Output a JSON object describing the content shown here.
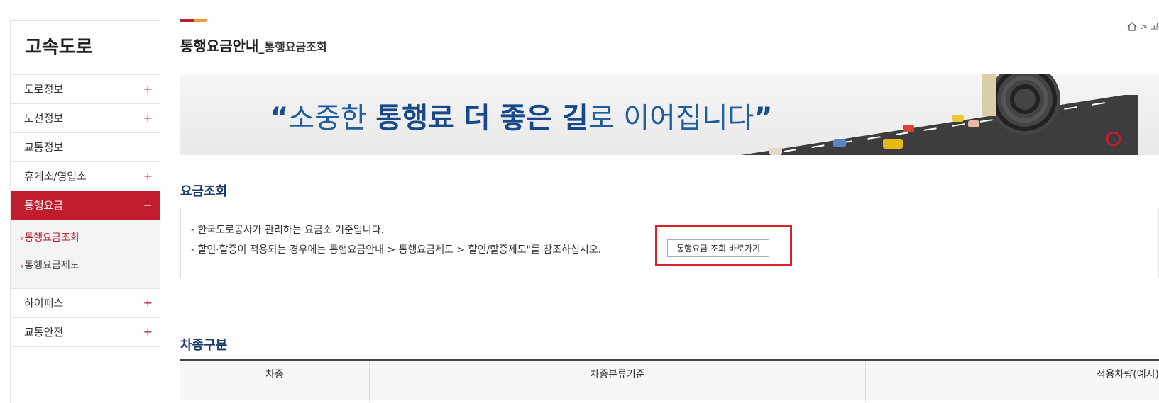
{
  "sidebar": {
    "title": "고속도로",
    "items": [
      {
        "label": "도로정보",
        "sign": "+"
      },
      {
        "label": "노선정보",
        "sign": "+"
      },
      {
        "label": "교통정보",
        "sign": ""
      },
      {
        "label": "휴게소/영업소",
        "sign": "+"
      },
      {
        "label": "통행요금",
        "sign": "−"
      }
    ],
    "sub_items": [
      {
        "label": "통행요금조회"
      },
      {
        "label": "통행요금제도"
      }
    ],
    "items_after": [
      {
        "label": "하이패스",
        "sign": "+"
      },
      {
        "label": "교통안전",
        "sign": "+"
      }
    ]
  },
  "header": {
    "title": "통행요금안내",
    "subtitle": "_통행요금조회",
    "breadcrumb": "> 고"
  },
  "banner": {
    "open_quote": "“",
    "text_1": "소중한 ",
    "bold_1": "통행료 더 좋은 길",
    "text_2": "로 이어집니다",
    "close_quote": "”"
  },
  "section_fee": {
    "title": "요금조회",
    "line_1": "- 한국도로공사가 관리하는 요금소 기준입니다.",
    "line_2": "- 할인·할증이 적용되는 경우에는 통행요금안내 > 통행요금제도 > 할인/할증제도\"를 참조하십시오.",
    "button_label": "통행요금 조회 바로가기"
  },
  "section_vehicle": {
    "title": "차종구분",
    "columns": [
      "차종",
      "차종분류기준",
      "적용차량(예시)"
    ]
  },
  "colors": {
    "accent_red": "#c01e2e",
    "title_navy": "#1a3a6c",
    "banner_blue": "#1e5da0"
  }
}
